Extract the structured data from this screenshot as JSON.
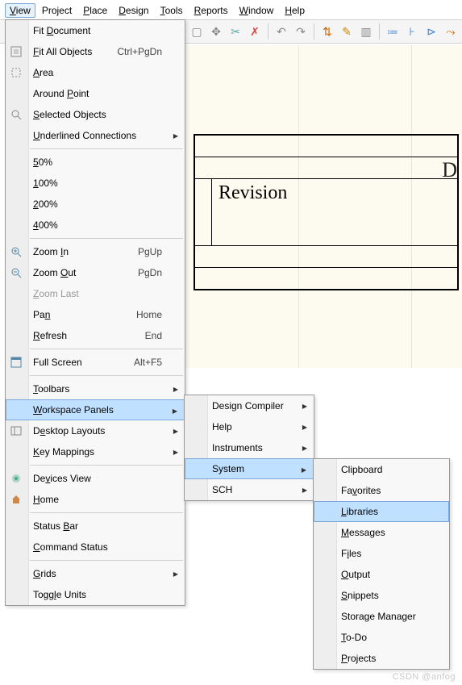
{
  "menubar": {
    "items": [
      {
        "u": "V",
        "rest": "iew"
      },
      {
        "pre": "Pro",
        "u": "j",
        "rest": "ect"
      },
      {
        "u": "P",
        "rest": "lace"
      },
      {
        "u": "D",
        "rest": "esign"
      },
      {
        "u": "T",
        "rest": "ools"
      },
      {
        "u": "R",
        "rest": "eports"
      },
      {
        "u": "W",
        "rest": "indow"
      },
      {
        "u": "H",
        "rest": "elp"
      }
    ],
    "active_index": 0
  },
  "canvas": {
    "revision_label": "Revision",
    "side_letter": "D"
  },
  "view_menu": {
    "fit_document": "Fit Document",
    "fit_all_objects": "Fit All Objects",
    "fit_all_objects_shortcut": "Ctrl+PgDn",
    "area": "Area",
    "around_point": "Around Point",
    "selected_objects": "Selected Objects",
    "underlined_connections": "Underlined Connections",
    "zoom50": "50%",
    "zoom100": "100%",
    "zoom200": "200%",
    "zoom400": "400%",
    "zoom_in": "Zoom In",
    "zoom_in_shortcut": "PgUp",
    "zoom_out": "Zoom Out",
    "zoom_out_shortcut": "PgDn",
    "zoom_last": "Zoom Last",
    "pan": "Pan",
    "pan_shortcut": "Home",
    "refresh": "Refresh",
    "refresh_shortcut": "End",
    "full_screen": "Full Screen",
    "full_screen_shortcut": "Alt+F5",
    "toolbars": "Toolbars",
    "workspace_panels": "Workspace Panels",
    "desktop_layouts": "Desktop Layouts",
    "key_mappings": "Key Mappings",
    "devices_view": "Devices View",
    "home": "Home",
    "status_bar": "Status Bar",
    "command_status": "Command Status",
    "grids": "Grids",
    "toggle_units": "Toggle Units"
  },
  "wp_menu": {
    "design_compiler": "Design Compiler",
    "help": "Help",
    "instruments": "Instruments",
    "system": "System",
    "sch": "SCH"
  },
  "sys_menu": {
    "clipboard": "Clipboard",
    "favorites": "Favorites",
    "libraries": "Libraries",
    "messages": "Messages",
    "files": "Files",
    "output": "Output",
    "snippets": "Snippets",
    "storage_manager": "Storage Manager",
    "todo": "To-Do",
    "projects": "Projects"
  },
  "watermark": "CSDN @anfog"
}
